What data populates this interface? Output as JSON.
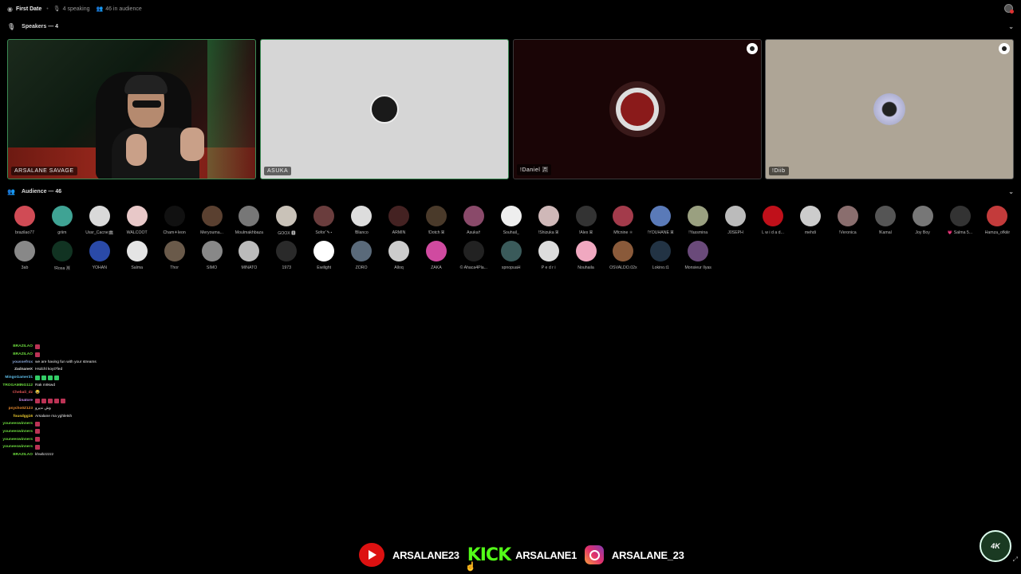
{
  "topbar": {
    "title": "First Date",
    "speaking": "4 speaking",
    "audience": "46 in audience"
  },
  "speakers_section": {
    "label": "Speakers — 4"
  },
  "speakers": [
    {
      "name": "ARSALANE SAVAGE",
      "type": "camera"
    },
    {
      "name": "ASUKA",
      "avatar_color": "#222222"
    },
    {
      "name": "!Daniel 🈷",
      "avatar_color": "#8a1a1a"
    },
    {
      "name": "!Diib",
      "avatar_color": "#c8c8e8"
    }
  ],
  "audience_section": {
    "label": "Audience — 46"
  },
  "audience": [
    {
      "name": "brazilao77",
      "color": "#d04b55"
    },
    {
      "name": "griim",
      "color": "#3fa394"
    },
    {
      "name": "Ussr_Cacne🏛",
      "color": "#d9d9d9"
    },
    {
      "name": "WALCOOT",
      "color": "#e8c8c8"
    },
    {
      "name": "Cham☀leon",
      "color": "#111111"
    },
    {
      "name": "Meryouma...",
      "color": "#5a4030"
    },
    {
      "name": "Moulmakhbaza",
      "color": "#777777"
    },
    {
      "name": "GOOX 🆇",
      "color": "#c9c2b8"
    },
    {
      "name": "Sofor˚✎⋆",
      "color": "#6a3d3d"
    },
    {
      "name": "!Blanco",
      "color": "#dddddd"
    },
    {
      "name": "ARMIN",
      "color": "#442222"
    },
    {
      "name": "!Dotch ꕤ",
      "color": "#4a3a2a"
    },
    {
      "name": "Asuka☨",
      "color": "#8a4a6a"
    },
    {
      "name": "Souhail_",
      "color": "#eeeeee"
    },
    {
      "name": "!Shizuka ꕤ",
      "color": "#cfb8b8"
    },
    {
      "name": "!Alex ꕤ",
      "color": "#333333"
    },
    {
      "name": "Mfcnine ⚛",
      "color": "#a33b4b"
    },
    {
      "name": "!YOUHANE ꕤ",
      "color": "#5a7ab8"
    },
    {
      "name": "!Yassmina",
      "color": "#9aa080"
    },
    {
      "name": "J0SEPH",
      "color": "#bbbbbb"
    },
    {
      "name": "L w i d a d...",
      "color": "#c0101a"
    },
    {
      "name": "mehdi",
      "color": "#cccccc"
    },
    {
      "name": "!Veronica",
      "color": "#8a6e6e"
    },
    {
      "name": "!Kamal",
      "color": "#555555"
    },
    {
      "name": "Joy Boy",
      "color": "#777777"
    },
    {
      "name": "💗 Salma 5...",
      "color": "#333333"
    },
    {
      "name": "Hamza_ofkiiir",
      "color": "#c33b3b"
    },
    {
      "name": "3ab",
      "color": "#888888"
    },
    {
      "name": "!Rosa 🈷",
      "color": "#113322"
    },
    {
      "name": "YOHAN",
      "color": "#2a4aa8"
    },
    {
      "name": "Salma",
      "color": "#e4e4e4"
    },
    {
      "name": "Thor",
      "color": "#6a5a4a"
    },
    {
      "name": "SIMO",
      "color": "#888888"
    },
    {
      "name": "MINATO",
      "color": "#bbbbbb"
    },
    {
      "name": "1973",
      "color": "#2a2a2a"
    },
    {
      "name": "Ewilight",
      "color": "#ffffff"
    },
    {
      "name": "ZORO",
      "color": "#5a6a7a"
    },
    {
      "name": "Alloq",
      "color": "#cccccc"
    },
    {
      "name": "ZAKA",
      "color": "#d04aa0"
    },
    {
      "name": "© Ahaca4Pla...",
      "color": "#222222"
    },
    {
      "name": "spnopuaH",
      "color": "#3a5a5a"
    },
    {
      "name": "P e d r i",
      "color": "#dddddd"
    },
    {
      "name": "Nouhaila",
      "color": "#f0a8c0"
    },
    {
      "name": "OSVALDO.02x",
      "color": "#8a5a3a"
    },
    {
      "name": "Lokino.t1",
      "color": "#223344"
    },
    {
      "name": "Monsieur Ilyas",
      "color": "#6a4a7a"
    }
  ],
  "chat": [
    {
      "user": "BRAZILAO",
      "user_color": "#6ddc3e",
      "text": "",
      "emotes": 1
    },
    {
      "user": "BRAZILAO",
      "user_color": "#6ddc3e",
      "text": "",
      "emotes": 1
    },
    {
      "user": "youssefrox",
      "user_color": "#8aa6d6",
      "text": "we are having fun with your streams",
      "emotes": 0
    },
    {
      "user": "ZadnaneX",
      "user_color": "#dddddd",
      "text": "Hsdchl koyt7fed",
      "emotes": 0
    },
    {
      "user": "MingoGamer31",
      "user_color": "#5fbde8",
      "text": "",
      "emotes": 4,
      "emote_style": "g"
    },
    {
      "user": "TROGAMING112",
      "user_color": "#6ddc3e",
      "text": "Rak m9swd",
      "emotes": 0
    },
    {
      "user": "Chebali_dz",
      "user_color": "#e05454",
      "text": "😂",
      "emotes": 0
    },
    {
      "user": "linatore",
      "user_color": "#c88ae8",
      "text": "",
      "emotes": 5
    },
    {
      "user": "psycho0Z123",
      "user_color": "#e88a2e",
      "text": "وش نديرو",
      "emotes": 0
    },
    {
      "user": "fousdgg16",
      "user_color": "#e8c82e",
      "text": "Arsalane ma yghletsh",
      "emotes": 0
    },
    {
      "user": "youneeswinners",
      "user_color": "#6ddc3e",
      "text": "",
      "emotes": 1
    },
    {
      "user": "youneeswinners",
      "user_color": "#6ddc3e",
      "text": "",
      "emotes": 1
    },
    {
      "user": "youneeswinners",
      "user_color": "#6ddc3e",
      "text": "",
      "emotes": 1
    },
    {
      "user": "youneeswinners",
      "user_color": "#6ddc3e",
      "text": "",
      "emotes": 1
    },
    {
      "user": "BRAZILAO",
      "user_color": "#6ddc3e",
      "text": "khwbzzzzz",
      "emotes": 0
    }
  ],
  "socials": {
    "youtube": "ARSALANE23",
    "kick_logo": "KICK",
    "kick": "ARSALANE1",
    "instagram": "ARSALANE_23"
  },
  "logo": {
    "text": "4K"
  }
}
